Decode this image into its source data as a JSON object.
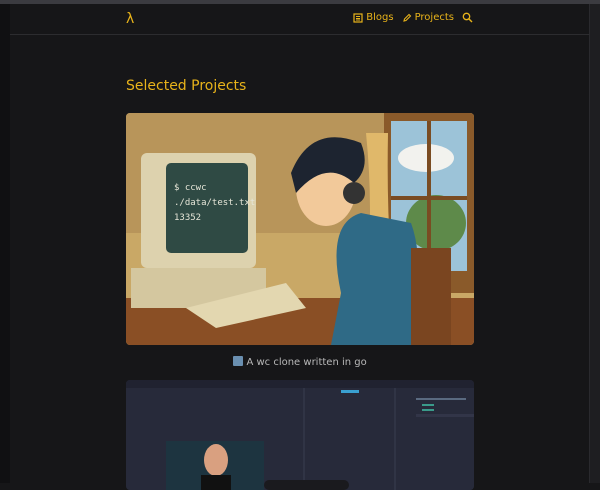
{
  "header": {
    "logo": "λ",
    "nav": [
      {
        "label": "Blogs",
        "icon": "newspaper-icon"
      },
      {
        "label": "Projects",
        "icon": "pencil-icon"
      }
    ],
    "search_icon": "search-icon"
  },
  "main": {
    "title": "Selected Projects",
    "projects": [
      {
        "caption_emoji": "🔢",
        "caption": "A wc clone written in go",
        "screen_lines": [
          "$ ccwc",
          "./data/test.txt",
          "13352"
        ]
      },
      {
        "caption": ""
      }
    ]
  },
  "colors": {
    "accent": "#e8b31a",
    "background": "#161618"
  }
}
